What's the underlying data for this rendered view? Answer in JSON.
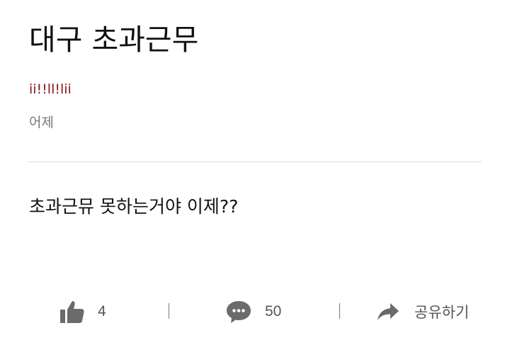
{
  "post": {
    "title": "대구 초과근무",
    "author": "ii!!ll!lii",
    "time": "어제",
    "body": "초과근뮤 못하는거야 이제??"
  },
  "actions": {
    "like_count": "4",
    "comment_count": "50",
    "share_label": "공유하기"
  },
  "icons": {
    "like": "thumbs-up-icon",
    "comment": "speech-bubble-icon",
    "share": "share-arrow-icon"
  },
  "colors": {
    "author": "#8b1a1a",
    "muted": "#777777",
    "icon": "#6b6b6b"
  }
}
